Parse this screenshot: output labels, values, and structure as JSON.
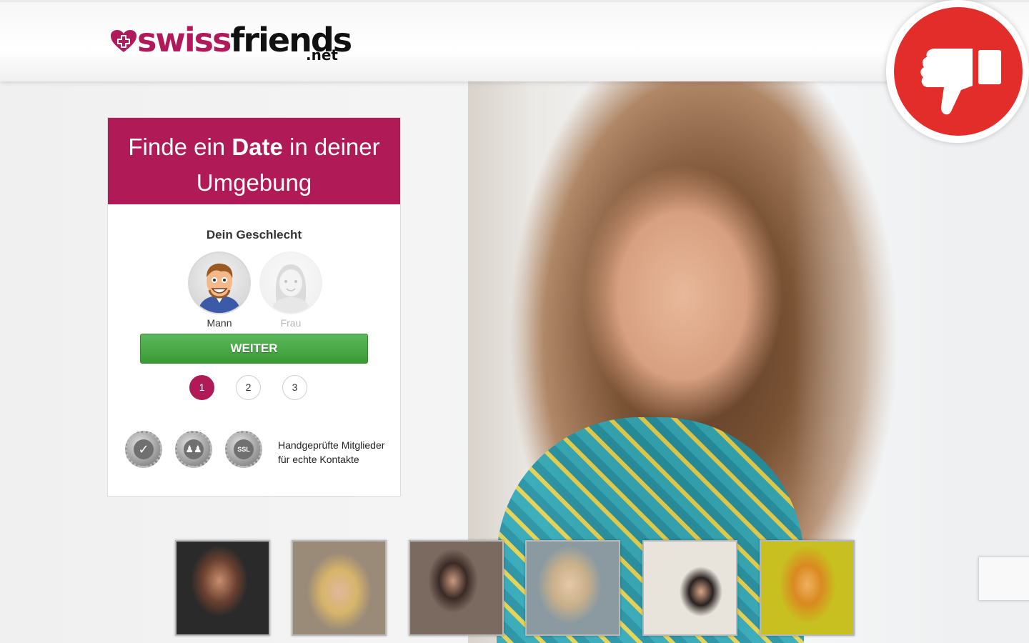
{
  "header": {
    "logo": {
      "swiss": "swiss",
      "friends": "friends",
      "tld": ".net"
    }
  },
  "form": {
    "headline_pre": "Finde ein ",
    "headline_bold": "Date",
    "headline_post": " in deiner Umgebung",
    "gender_title": "Dein Geschlecht",
    "genders": [
      {
        "label": "Mann",
        "selected": true
      },
      {
        "label": "Frau",
        "selected": false
      }
    ],
    "submit_label": "WEITER",
    "steps": [
      "1",
      "2",
      "3"
    ],
    "active_step": "1",
    "trust_icons": [
      "verified-check-icon",
      "members-group-icon",
      "ssl-lock-icon"
    ],
    "trust_text": "Handgeprüfte Mitglieder für echte Kontakte"
  },
  "badge": {
    "icon": "thumbs-down-icon",
    "color": "#e32d2a"
  },
  "members": {
    "thumbnails": [
      {
        "icon": "member-photo-1",
        "tone": "#8a5a3a"
      },
      {
        "icon": "member-photo-2",
        "tone": "#c9a56b"
      },
      {
        "icon": "member-photo-3",
        "tone": "#5a4a40"
      },
      {
        "icon": "member-photo-4",
        "tone": "#b9a98a"
      },
      {
        "icon": "member-photo-5",
        "tone": "#3a3330"
      },
      {
        "icon": "member-photo-6",
        "tone": "#d9b02a"
      }
    ]
  },
  "colors": {
    "brand": "#b01a57",
    "cta": "#4caf50"
  }
}
